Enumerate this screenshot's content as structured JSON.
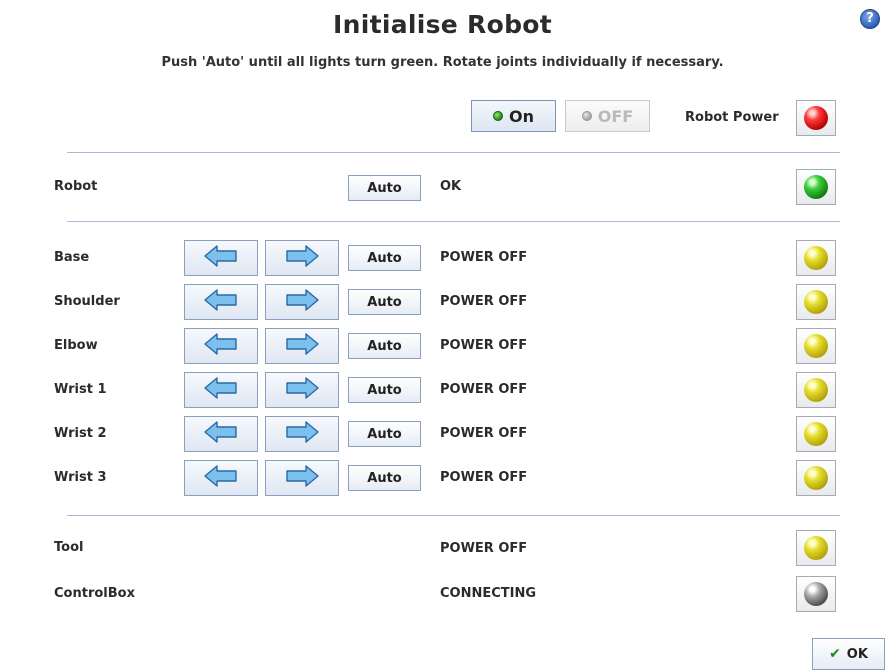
{
  "header": {
    "title": "Initialise Robot",
    "subtitle": "Push 'Auto' until all lights turn green. Rotate joints individually if necessary.",
    "help_icon": "help-icon"
  },
  "power": {
    "on_label": "On",
    "off_label": "OFF",
    "robot_power_label": "Robot Power",
    "robot_power_light": "red"
  },
  "robot_row": {
    "label": "Robot",
    "auto_label": "Auto",
    "status": "OK",
    "light": "green"
  },
  "joints": [
    {
      "label": "Base",
      "auto_label": "Auto",
      "status": "POWER OFF",
      "light": "yellow"
    },
    {
      "label": "Shoulder",
      "auto_label": "Auto",
      "status": "POWER OFF",
      "light": "yellow"
    },
    {
      "label": "Elbow",
      "auto_label": "Auto",
      "status": "POWER OFF",
      "light": "yellow"
    },
    {
      "label": "Wrist 1",
      "auto_label": "Auto",
      "status": "POWER OFF",
      "light": "yellow"
    },
    {
      "label": "Wrist 2",
      "auto_label": "Auto",
      "status": "POWER OFF",
      "light": "yellow"
    },
    {
      "label": "Wrist 3",
      "auto_label": "Auto",
      "status": "POWER OFF",
      "light": "yellow"
    }
  ],
  "tool_row": {
    "label": "Tool",
    "status": "POWER OFF",
    "light": "yellow"
  },
  "controlbox_row": {
    "label": "ControlBox",
    "status": "CONNECTING",
    "light": "grey"
  },
  "footer": {
    "ok_label": "OK"
  },
  "colors": {
    "accent_line": "#a9bad4",
    "button_border": "#8c9fbd",
    "arrow_fill": "#7cc0f0"
  }
}
